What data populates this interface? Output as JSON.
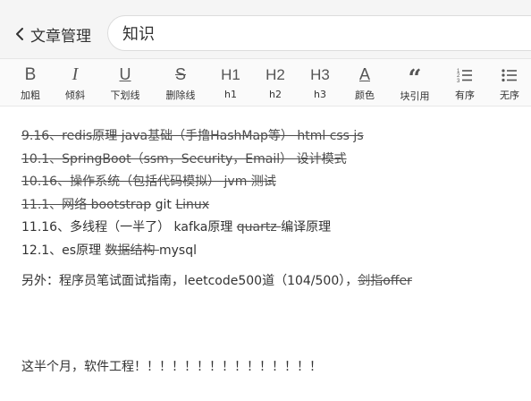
{
  "header": {
    "back_label": "文章管理",
    "title_value": "知识"
  },
  "toolbar": {
    "items": [
      {
        "glyph": "B",
        "label": "加粗"
      },
      {
        "glyph": "I",
        "label": "倾斜"
      },
      {
        "glyph": "U",
        "label": "下划线"
      },
      {
        "glyph": "S",
        "label": "删除线"
      },
      {
        "glyph": "H1",
        "label": "h1"
      },
      {
        "glyph": "H2",
        "label": "h2"
      },
      {
        "glyph": "H3",
        "label": "h3"
      },
      {
        "glyph": "A",
        "label": "颜色"
      },
      {
        "glyph": "“",
        "label": "块引用"
      },
      {
        "glyph": "ol",
        "label": "有序"
      },
      {
        "glyph": "ul",
        "label": "无序"
      }
    ]
  },
  "content": {
    "l1": "9.16、redis原理 java基础（手撸HashMap等） html css js",
    "l2": "10.1、SpringBoot（ssm，Security，Email） 设计模式",
    "l3": "10.16、操作系统（包括代码模拟） jvm  测试",
    "l4a": "11.1、网络 bootstrap",
    "l4b": " git ",
    "l4c": "Linux",
    "l5": "11.16、多线程（一半了） kafka原理 ",
    "l5s": "quartz ",
    "l5b": "编译原理",
    "l6a": "12.1、es原理 ",
    "l6s": "数据结构 ",
    "l6b": "mysql",
    "p2a": "另外：程序员笔试面试指南，leetcode500道（104/500），",
    "p2s": "剑指offer",
    "p3": "这半个月，软件工程！！！！！！！！！！！！！！！"
  }
}
